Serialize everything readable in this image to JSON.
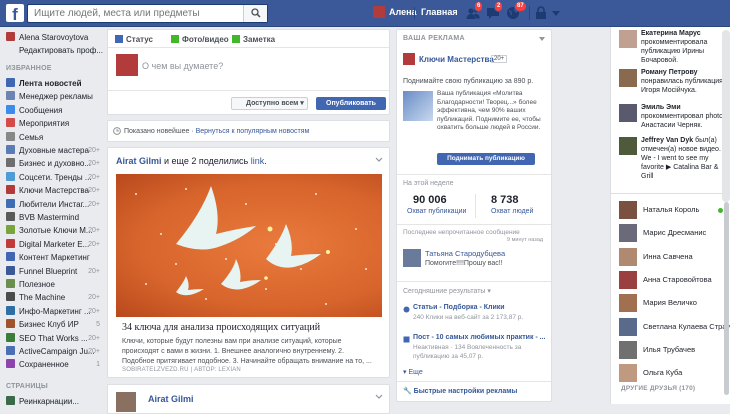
{
  "topbar": {
    "search_placeholder": "Ищите людей, места или предметы",
    "user_name": "Алена",
    "home_label": "Главная",
    "friend_requests_badge": "6",
    "messages_badge": "2",
    "notifications_badge": "87",
    "brand_color": "#3b5998"
  },
  "left_nav": {
    "profile_name": "Alena Starovoytova",
    "edit_profile": "Редактировать проф...",
    "favorites_header": "ИЗБРАННОЕ",
    "items": [
      {
        "label": "Лента новостей",
        "count": "",
        "icon": "news-feed-icon",
        "color": "#4267b2"
      },
      {
        "label": "Менеджер рекламы",
        "count": "",
        "icon": "ads-manager-icon",
        "color": "#6c83b3"
      },
      {
        "label": "Сообщения",
        "count": "",
        "icon": "messages-icon",
        "color": "#3b8ced"
      },
      {
        "label": "Мероприятия",
        "count": "",
        "icon": "events-icon",
        "color": "#d34b4b"
      },
      {
        "label": "Семья",
        "count": "",
        "icon": "family-icon",
        "color": "#888888"
      },
      {
        "label": "Духовные мастера",
        "count": "20+",
        "icon": "group-icon",
        "color": "#5b7bb5"
      },
      {
        "label": "Бизнес и духовно...",
        "count": "20+",
        "icon": "group-icon",
        "color": "#6e6e6e"
      },
      {
        "label": "Соцсети. Тренды ...",
        "count": "20+",
        "icon": "group-icon",
        "color": "#4e9bd6"
      },
      {
        "label": "Ключи Мастерства",
        "count": "20+",
        "icon": "page-icon",
        "color": "#b23a3a"
      },
      {
        "label": "Любители Инстаг...",
        "count": "20+",
        "icon": "group-icon",
        "color": "#3d6db5"
      },
      {
        "label": "BVB Mastermind",
        "count": "",
        "icon": "group-icon",
        "color": "#5a5a5a"
      },
      {
        "label": "Золотые Ключи М...",
        "count": "20+",
        "icon": "group-icon",
        "color": "#7aa53c"
      },
      {
        "label": "Digital Marketer E...",
        "count": "20+",
        "icon": "group-icon",
        "color": "#c23b3b"
      },
      {
        "label": "Контент Маркетинг",
        "count": "",
        "icon": "group-icon",
        "color": "#4267b2"
      },
      {
        "label": "Funnel Blueprint",
        "count": "20+",
        "icon": "group-icon",
        "color": "#3b5998"
      },
      {
        "label": "Полезное",
        "count": "",
        "icon": "group-icon",
        "color": "#6b8e4e"
      },
      {
        "label": "The Machine",
        "count": "20+",
        "icon": "group-icon",
        "color": "#4c4c4c"
      },
      {
        "label": "Инфо-Маркетинг ...",
        "count": "20+",
        "icon": "group-icon",
        "color": "#2f6fa8"
      },
      {
        "label": "Бизнес Клуб ИР",
        "count": "5",
        "icon": "group-icon",
        "color": "#a0522d"
      },
      {
        "label": "SEO That Works ...",
        "count": "20+",
        "icon": "group-icon",
        "color": "#3b7d3b"
      },
      {
        "label": "ActiveCampaign Ju...",
        "count": "20+",
        "icon": "group-icon",
        "color": "#4a6fb5"
      },
      {
        "label": "Сохраненное",
        "count": "1",
        "icon": "saved-icon",
        "color": "#8e44ad"
      }
    ],
    "pages_header": "СТРАНИЦЫ",
    "pages_first": "Реинкарнации..."
  },
  "composer": {
    "tab_status": "Статус",
    "tab_photo": "Фото/видео",
    "tab_note": "Заметка",
    "placeholder": "О чем вы думаете?",
    "privacy": "Доступно всем",
    "post_button": "Опубликовать"
  },
  "sort_bar": {
    "text": "Показано новейшее · ",
    "link": "Вернуться к популярным новостям"
  },
  "post1": {
    "author": "Airat Gilmi",
    "action": " и еще 2 поделились ",
    "link_word": "link",
    "title": "34 ключа для анализа происходящих ситуаций",
    "desc": "Ключи, которые будут полезны вам при анализе ситуаций, которые происходят с вами в жизни. 1. Внешнее аналогично внутреннему. 2. Подобное притягивает подобное. 3. Начинайте обращать внимание на то, ...",
    "source": "SOBIRATELZVEZD.RU | АВТОР: LEXIAN"
  },
  "post2": {
    "author": "Airat Gilmi"
  },
  "ads": {
    "header": "ВАША РЕКЛАМА",
    "page_name": "Ключи Мастерства",
    "page_badge": "20+",
    "boost_title": "Поднимайте свою публикацию за 890 р.",
    "boost_text": "Ваша публикация «Молитва Благодарности! Творец...» более эффективна, чем 90% ваших публикаций. Поднимите ее, чтобы охватить больше людей в России.",
    "boost_button": "Поднимать публикацию",
    "week_header": "На этой неделе",
    "reach_value": "90 006",
    "reach_label": "Охват публикации",
    "people_value": "8 738",
    "people_label": "Охват людей",
    "unread_header": "Последнее непрочитанное сообщение",
    "unread_time": "9 минут назад",
    "msg_name": "Татьяна Стародубцева",
    "msg_text": "Помогите!!!!Прошу вас!!",
    "results_header": "Сегодняшние результаты",
    "result1_title": "Статьи - Подборка - Клики",
    "result1_text": "240 Клики на веб-сайт за 2 173,87 р.",
    "result2_title": "Пост - 10 самых любимых практик - ...",
    "result2_text": "Неактивная · 134 Вовлеченность за публикацию за 45,07 р.",
    "more": "Еще",
    "quick_settings": "Быстрые настройки рекламы"
  },
  "ticker": [
    {
      "name": "Екатерина Марус",
      "text": "прокомментировала публикацию Ирины Бочаровой.",
      "color": "#c0a090"
    },
    {
      "name": "Роману Петрову",
      "text": "понравилась публикация Игоря Мосійчука.",
      "color": "#8a6a4e"
    },
    {
      "name": "Эмиль Эми",
      "text": "прокомментировал photo Анастасии Черняк.",
      "color": "#5a5a6e"
    },
    {
      "name": "Jeffrey Van Dyk",
      "text": "был(а) отмечен(а) новое видео. We - I went to see my favorite ▶ Catalina Bar & Grill",
      "color": "#4e5a3a"
    }
  ],
  "chat": {
    "friends": [
      {
        "name": "Наталья Король",
        "online": true,
        "color": "#7a5040"
      },
      {
        "name": "Марис Дресманис",
        "online": false,
        "color": "#6a6a7a"
      },
      {
        "name": "Инна Савчена",
        "online": false,
        "color": "#b08a70"
      },
      {
        "name": "Анна Старовойтова",
        "online": false,
        "color": "#9a4040"
      },
      {
        "name": "Мария Величко",
        "online": false,
        "color": "#a07050"
      },
      {
        "name": "Светлана Кулаева Страусс",
        "online": false,
        "color": "#5a6a8a"
      },
      {
        "name": "Илья Трубачев",
        "online": false,
        "color": "#707070"
      },
      {
        "name": "Ольга Куба",
        "online": false,
        "color": "#c09a80"
      }
    ],
    "other_header": "ДРУГИЕ ДРУЗЬЯ (170)"
  }
}
